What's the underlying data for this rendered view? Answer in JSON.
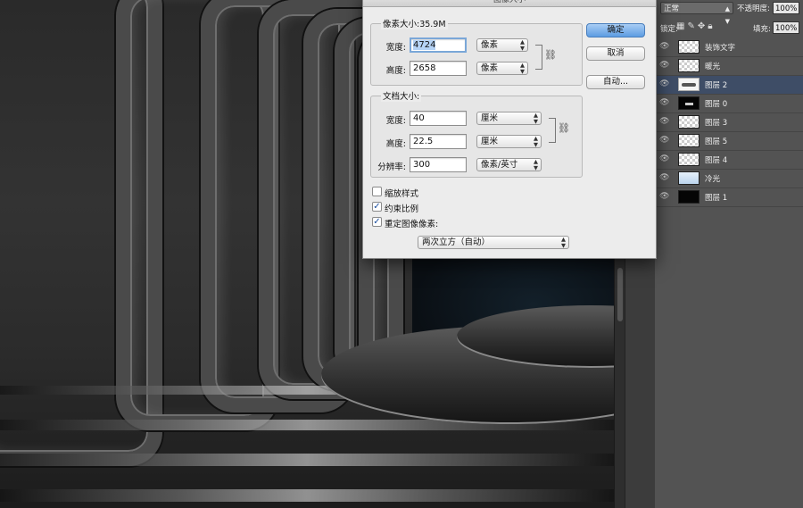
{
  "dialog": {
    "title": "图像大小",
    "pixel_dimensions": {
      "header": "像素大小:35.9M",
      "width_label": "宽度:",
      "width_value": "4724",
      "width_unit": "像素",
      "height_label": "高度:",
      "height_value": "2658",
      "height_unit": "像素"
    },
    "document_size": {
      "header": "文档大小:",
      "width_label": "宽度:",
      "width_value": "40",
      "width_unit": "厘米",
      "height_label": "高度:",
      "height_value": "22.5",
      "height_unit": "厘米",
      "resolution_label": "分辨率:",
      "resolution_value": "300",
      "resolution_unit": "像素/英寸"
    },
    "options": {
      "scale_styles": {
        "label": "缩放样式",
        "checked": false
      },
      "constrain_proportions": {
        "label": "约束比例",
        "checked": true
      },
      "resample": {
        "label": "重定图像像素:",
        "checked": true
      }
    },
    "resample_method": "两次立方（自动）",
    "buttons": {
      "ok": "确定",
      "cancel": "取消",
      "auto": "自动..."
    }
  },
  "layers_panel": {
    "blend_mode": "正常",
    "opacity_label": "不透明度:",
    "opacity_value": "100%",
    "lock_label": "锁定:",
    "fill_label": "填充:",
    "fill_value": "100%",
    "layers": [
      {
        "name": "装饰文字",
        "thumb": "checker",
        "active": false
      },
      {
        "name": "暖光",
        "thumb": "checker",
        "active": false
      },
      {
        "name": "图层 2",
        "thumb": "selected-white",
        "active": true
      },
      {
        "name": "图层 0",
        "thumb": "blackbar",
        "active": false
      },
      {
        "name": "图层 3",
        "thumb": "checker",
        "active": false
      },
      {
        "name": "图层 5",
        "thumb": "checker",
        "active": false
      },
      {
        "name": "图层 4",
        "thumb": "checker",
        "active": false
      },
      {
        "name": "冷光",
        "thumb": "blue",
        "active": false
      },
      {
        "name": "图层 1",
        "thumb": "black",
        "active": false
      }
    ]
  },
  "colors": {
    "dialog_bg": "#ececec",
    "primary_button": "#5d9ce2",
    "panel_bg": "#535353",
    "active_layer": "#3e4d66"
  }
}
